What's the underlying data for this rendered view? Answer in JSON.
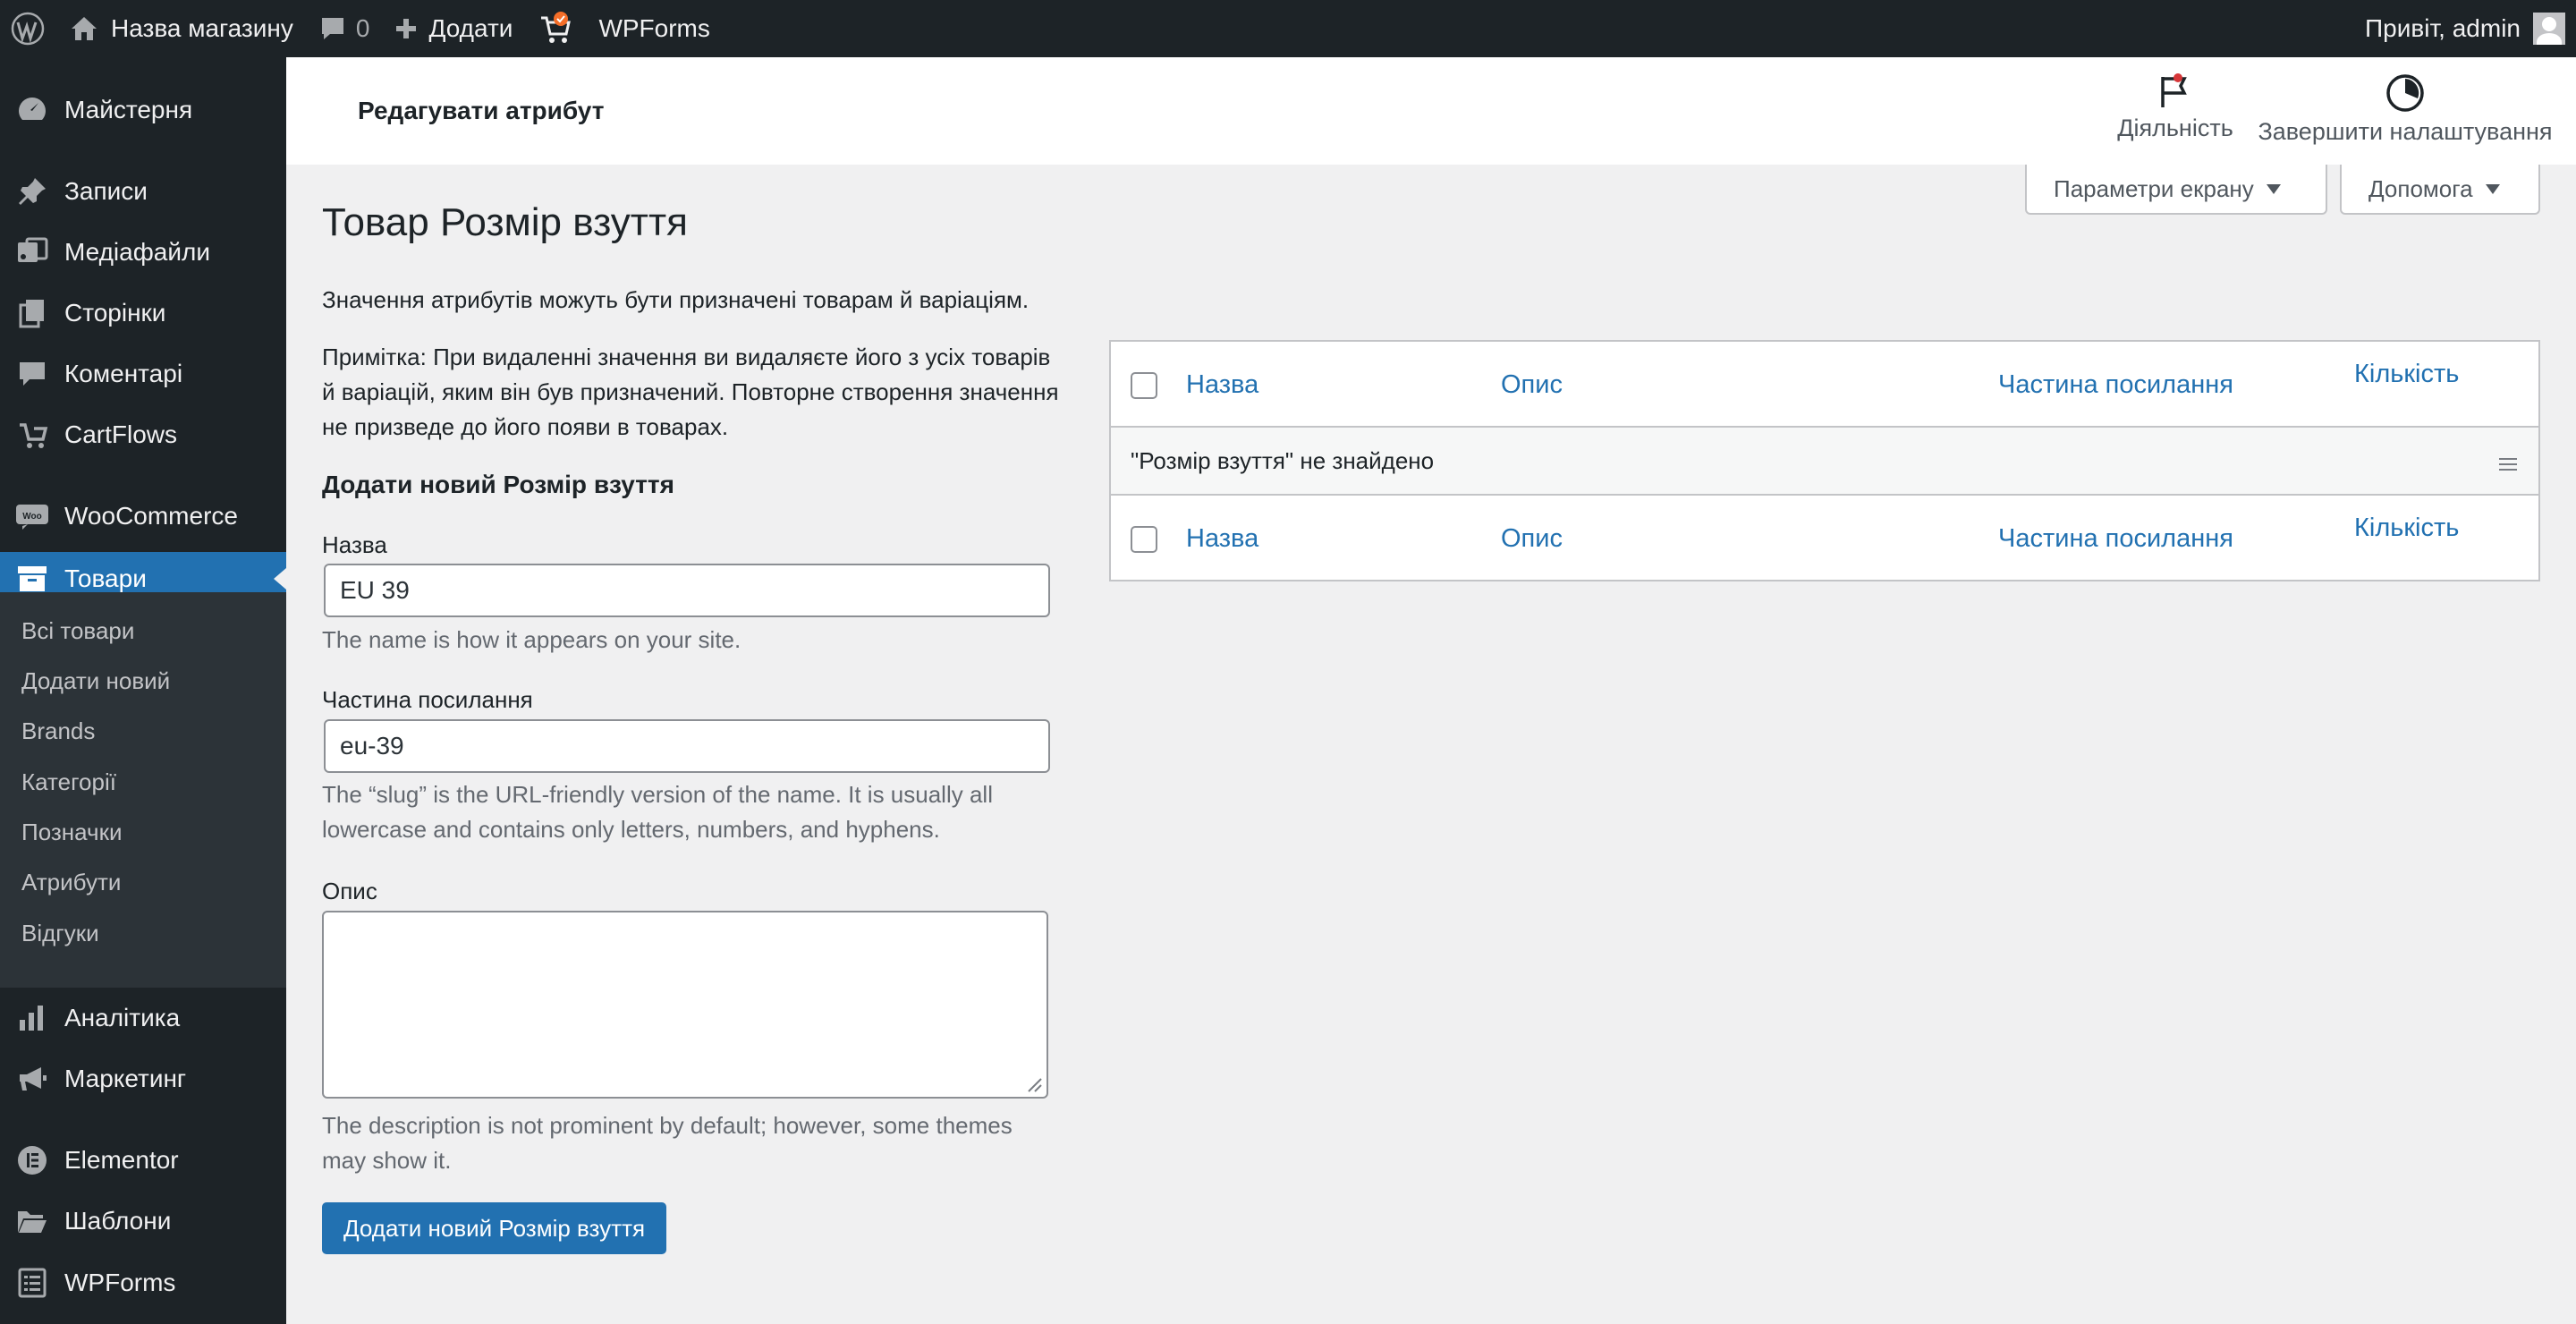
{
  "adminbar": {
    "site_name": "Назва магазину",
    "comments_count": "0",
    "new_label": "Додати",
    "wpforms_label": "WPForms",
    "greeting": "Привіт, admin"
  },
  "sidebar": {
    "items": [
      {
        "label": "Майстерня",
        "icon": "dashboard-icon"
      },
      {
        "label": "Записи",
        "icon": "pin-icon"
      },
      {
        "label": "Медіафайли",
        "icon": "media-icon"
      },
      {
        "label": "Сторінки",
        "icon": "pages-icon"
      },
      {
        "label": "Коментарі",
        "icon": "comment-icon"
      },
      {
        "label": "CartFlows",
        "icon": "cartflows-icon"
      },
      {
        "label": "WooCommerce",
        "icon": "woo-icon"
      },
      {
        "label": "Товари",
        "icon": "products-icon"
      },
      {
        "label": "Аналітика",
        "icon": "chart-icon"
      },
      {
        "label": "Маркетинг",
        "icon": "megaphone-icon"
      },
      {
        "label": "Elementor",
        "icon": "elementor-icon"
      },
      {
        "label": "Шаблони",
        "icon": "folder-icon"
      },
      {
        "label": "WPForms",
        "icon": "form-icon"
      }
    ],
    "submenu": [
      "Всі товари",
      "Додати новий",
      "Brands",
      "Категорії",
      "Позначки",
      "Атрибути",
      "Відгуки"
    ]
  },
  "header": {
    "title": "Редагувати атрибут",
    "activity_label": "Діяльність",
    "finish_setup_label": "Завершити налаштування"
  },
  "screen_meta": {
    "screen_options": "Параметри екрану",
    "help": "Допомога"
  },
  "main": {
    "title": "Товар Розмір взуття",
    "intro": "Значення атрибутів можуть бути призначені товарам й варіаціям.",
    "note": "Примітка: При видаленні значення ви видаляєте його з усіх товарів й варіацій, яким він був призначений. Повторне створення значення не призведе до його появи в товарах.",
    "form": {
      "title": "Додати новий Розмір взуття",
      "name_label": "Назва",
      "name_value": "EU 39",
      "name_hint": "The name is how it appears on your site.",
      "slug_label": "Частина посилання",
      "slug_value": "eu-39",
      "slug_hint": "The “slug” is the URL-friendly version of the name. It is usually all lowercase and contains only letters, numbers, and hyphens.",
      "desc_label": "Опис",
      "desc_value": "",
      "desc_hint": "The description is not prominent by default; however, some themes may show it.",
      "submit_label": "Додати новий Розмір взуття"
    },
    "table": {
      "columns": [
        "Назва",
        "Опис",
        "Частина посилання",
        "Кількість"
      ],
      "empty_message": "\"Розмір взуття\" не знайдено"
    }
  },
  "colors": {
    "adminbar_bg": "#1d2327",
    "accent": "#2271b1",
    "page_bg": "#f0f0f1",
    "notification_dot": "#d63638"
  }
}
